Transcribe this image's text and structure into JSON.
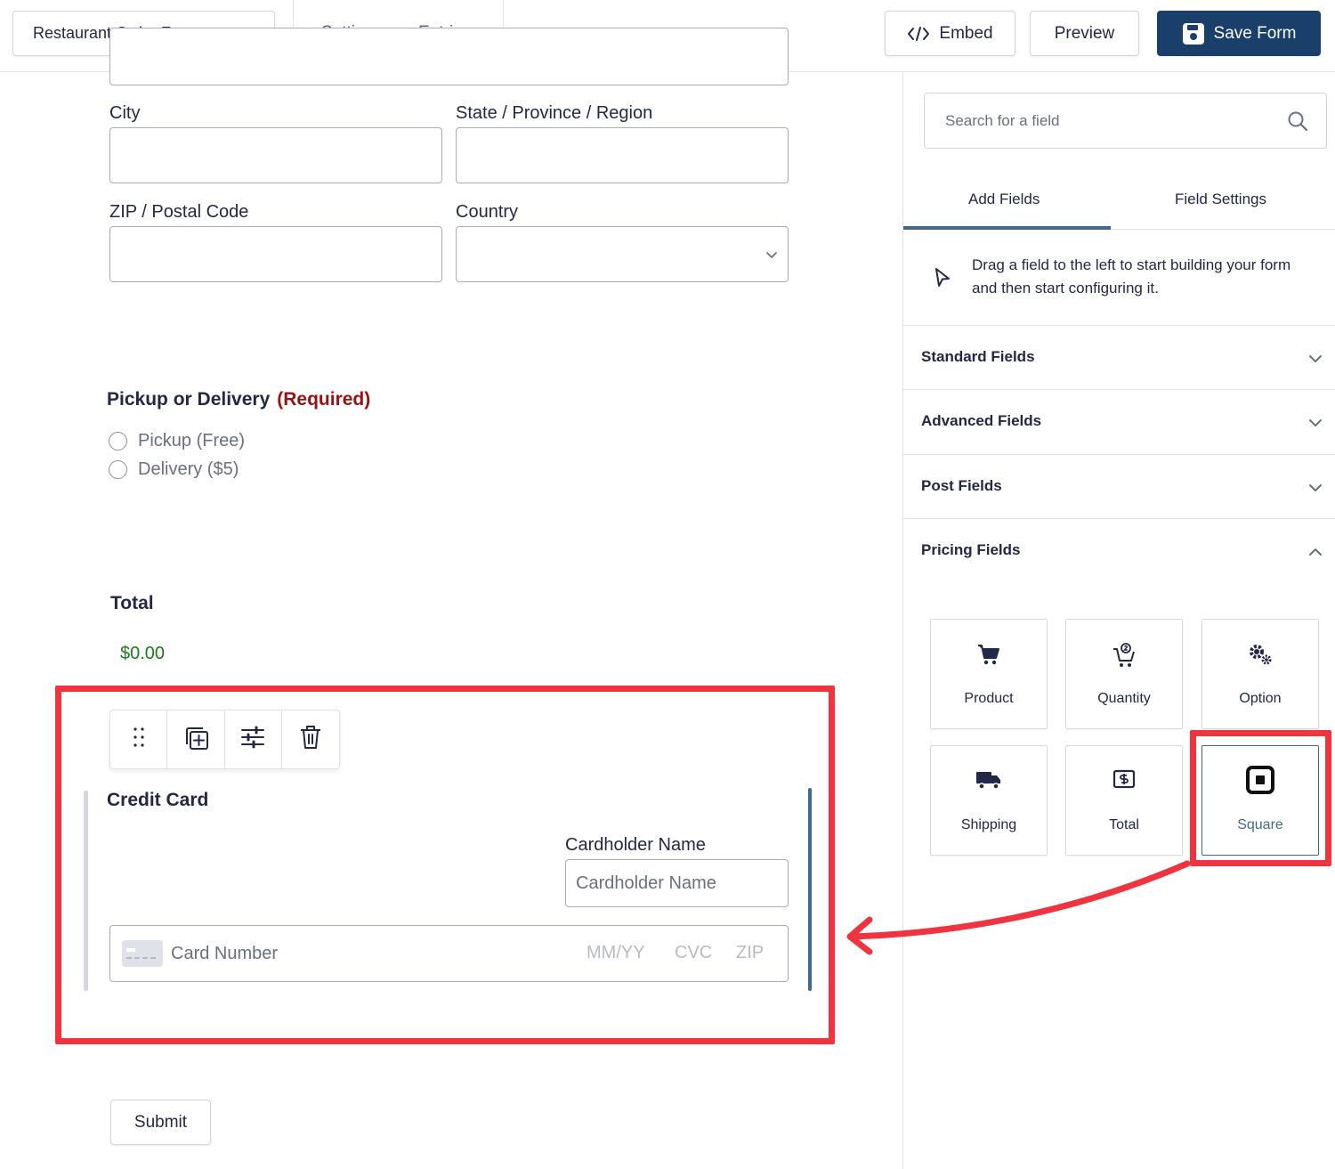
{
  "topbar": {
    "form_name": "Restaurant Order Form",
    "nav": [
      "Settings",
      "Entries"
    ],
    "embed_label": "Embed",
    "preview_label": "Preview",
    "save_label": "Save Form"
  },
  "form": {
    "city_label": "City",
    "state_label": "State / Province / Region",
    "zip_label": "ZIP / Postal Code",
    "country_label": "Country",
    "pickup": {
      "label": "Pickup or Delivery",
      "required": "(Required)",
      "options": [
        "Pickup (Free)",
        "Delivery ($5)"
      ]
    },
    "total": {
      "label": "Total",
      "value": "$0.00"
    },
    "credit_card": {
      "label": "Credit Card",
      "cardholder_label": "Cardholder Name",
      "cardholder_placeholder": "Cardholder Name",
      "card_number_placeholder": "Card Number",
      "expiry_placeholder": "MM/YY",
      "cvc_placeholder": "CVC",
      "zip_placeholder": "ZIP"
    },
    "submit_label": "Submit"
  },
  "sidebar": {
    "search_placeholder": "Search for a field",
    "tabs": [
      "Add Fields",
      "Field Settings"
    ],
    "hint": "Drag a field to the left to start building your form and then start configuring it.",
    "groups": [
      "Standard Fields",
      "Advanced Fields",
      "Post Fields",
      "Pricing Fields"
    ],
    "pricing_fields": [
      {
        "label": "Product",
        "icon": "cart-icon"
      },
      {
        "label": "Quantity",
        "icon": "cart-quantity-icon"
      },
      {
        "label": "Option",
        "icon": "gears-icon"
      },
      {
        "label": "Shipping",
        "icon": "truck-icon"
      },
      {
        "label": "Total",
        "icon": "dollar-bill-icon"
      },
      {
        "label": "Square",
        "icon": "square-logo-icon"
      }
    ]
  },
  "colors": {
    "primary": "#1b3f6b",
    "accent": "#3e6a8e",
    "highlight": "#f0343f",
    "required": "#9b1111",
    "price": "#1b7b1b"
  }
}
